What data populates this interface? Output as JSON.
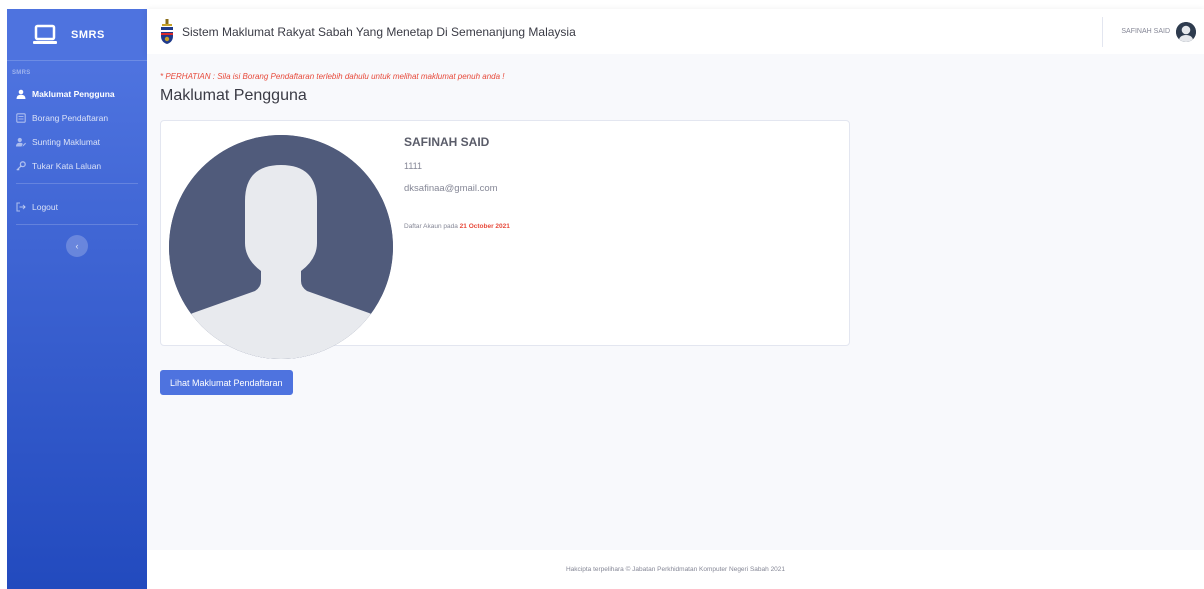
{
  "sidebar": {
    "brand": "SMRS",
    "heading": "SMRS",
    "items": [
      {
        "label": "Maklumat Pengguna",
        "icon": "user-icon",
        "active": true
      },
      {
        "label": "Borang Pendaftaran",
        "icon": "form-icon",
        "active": false
      },
      {
        "label": "Sunting Maklumat",
        "icon": "user-edit-icon",
        "active": false
      },
      {
        "label": "Tukar Kata Laluan",
        "icon": "key-icon",
        "active": false
      }
    ],
    "logout": {
      "label": "Logout",
      "icon": "sign-out-icon"
    },
    "toggle_icon": "chevron-left-icon"
  },
  "topbar": {
    "title": "Sistem Maklumat Rakyat Sabah Yang Menetap Di Semenanjung Malaysia",
    "user_name": "SAFINAH SAID"
  },
  "main": {
    "notice": "* PERHATIAN : Sila isi Borang Pendaftaran terlebih dahulu untuk melihat maklumat penuh anda !",
    "page_title": "Maklumat Pengguna",
    "profile": {
      "name": "SAFINAH SAID",
      "id": "1111",
      "email": "dksafinaa@gmail.com",
      "registered_prefix": "Daftar Akaun pada",
      "registered_date": "21 October 2021"
    },
    "view_button": "Lihat Maklumat Pendaftaran"
  },
  "footer": {
    "text": "Hakcipta terpelihara © Jabatan Perkhidmatan Komputer Negeri Sabah 2021"
  },
  "colors": {
    "primary": "#4e73df",
    "primary_dark": "#224abe",
    "danger": "#e74a3b",
    "background": "#f8f9fc",
    "text": "#3a3b45",
    "muted": "#858796"
  }
}
